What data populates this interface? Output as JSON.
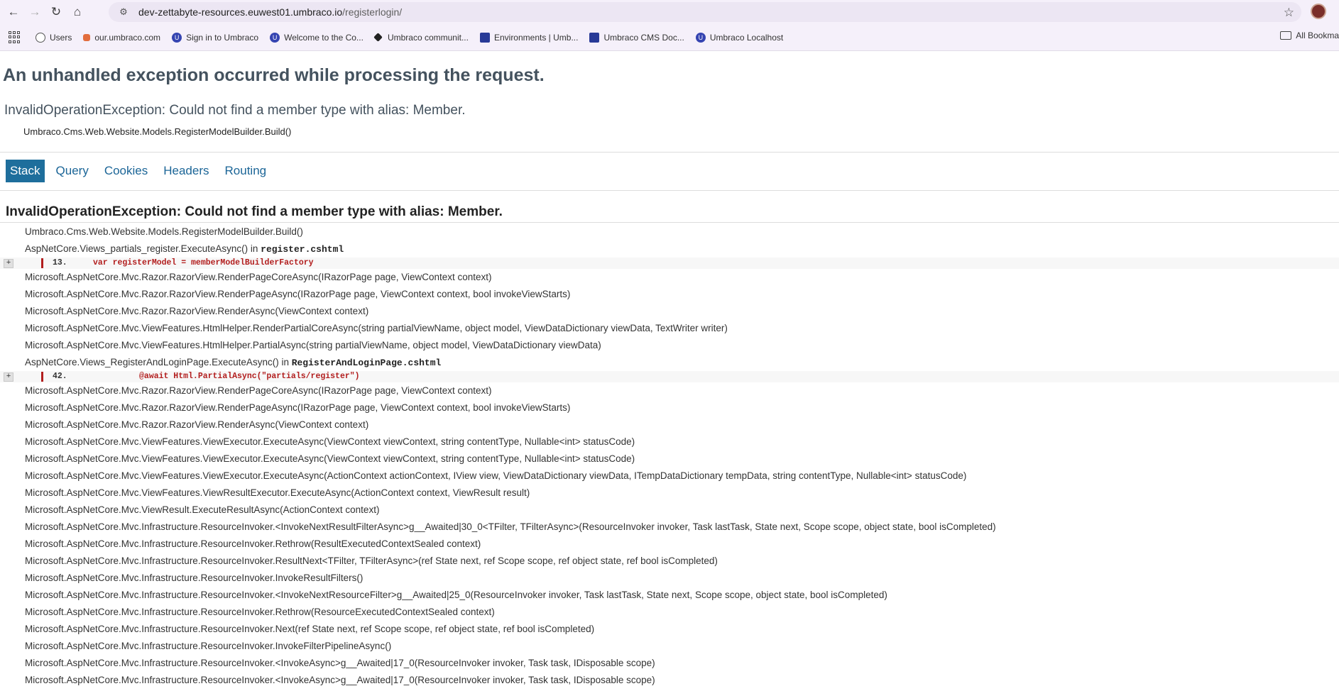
{
  "browser": {
    "url_host": "dev-zettabyte-resources.euwest01.umbraco.io",
    "url_path": "/registerlogin/",
    "bookmarks": [
      {
        "label": "Users",
        "icon": "globe-icon"
      },
      {
        "label": "our.umbraco.com",
        "icon": "umbraco-small-icon"
      },
      {
        "label": "Sign in to Umbraco",
        "icon": "umbraco-icon"
      },
      {
        "label": "Welcome to the Co...",
        "icon": "umbraco-icon"
      },
      {
        "label": "Umbraco communit...",
        "icon": "diamond-icon"
      },
      {
        "label": "Environments | Umb...",
        "icon": "flag-icon"
      },
      {
        "label": "Umbraco CMS Doc...",
        "icon": "flag-icon"
      },
      {
        "label": "Umbraco Localhost",
        "icon": "umbraco-icon"
      }
    ],
    "all_bookmarks_label": "All Bookma"
  },
  "error": {
    "title": "An unhandled exception occurred while processing the request.",
    "message": "InvalidOperationException: Could not find a member type with alias: Member.",
    "location": "Umbraco.Cms.Web.Website.Models.RegisterModelBuilder.Build()"
  },
  "tabs": [
    {
      "label": "Stack",
      "active": true
    },
    {
      "label": "Query",
      "active": false
    },
    {
      "label": "Cookies",
      "active": false
    },
    {
      "label": "Headers",
      "active": false
    },
    {
      "label": "Routing",
      "active": false
    }
  ],
  "stack": {
    "exception_title": "InvalidOperationException: Could not find a member type with alias: Member.",
    "frames": [
      {
        "text": "Umbraco.Cms.Web.Website.Models.RegisterModelBuilder.Build()"
      },
      {
        "text": "AspNetCore.Views_partials_register.ExecuteAsync() in ",
        "file": "register.cshtml",
        "code": {
          "line": "13.",
          "source": "var registerModel = memberModelBuilderFactory",
          "indent": 0
        }
      },
      {
        "text": "Microsoft.AspNetCore.Mvc.Razor.RazorView.RenderPageCoreAsync(IRazorPage page, ViewContext context)"
      },
      {
        "text": "Microsoft.AspNetCore.Mvc.Razor.RazorView.RenderPageAsync(IRazorPage page, ViewContext context, bool invokeViewStarts)"
      },
      {
        "text": "Microsoft.AspNetCore.Mvc.Razor.RazorView.RenderAsync(ViewContext context)"
      },
      {
        "text": "Microsoft.AspNetCore.Mvc.ViewFeatures.HtmlHelper.RenderPartialCoreAsync(string partialViewName, object model, ViewDataDictionary viewData, TextWriter writer)"
      },
      {
        "text": "Microsoft.AspNetCore.Mvc.ViewFeatures.HtmlHelper.PartialAsync(string partialViewName, object model, ViewDataDictionary viewData)"
      },
      {
        "text": "AspNetCore.Views_RegisterAndLoginPage.ExecuteAsync() in ",
        "file": "RegisterAndLoginPage.cshtml",
        "code": {
          "line": "42.",
          "source": "@await Html.PartialAsync(\"partials/register\")",
          "indent": 1
        }
      },
      {
        "text": "Microsoft.AspNetCore.Mvc.Razor.RazorView.RenderPageCoreAsync(IRazorPage page, ViewContext context)"
      },
      {
        "text": "Microsoft.AspNetCore.Mvc.Razor.RazorView.RenderPageAsync(IRazorPage page, ViewContext context, bool invokeViewStarts)"
      },
      {
        "text": "Microsoft.AspNetCore.Mvc.Razor.RazorView.RenderAsync(ViewContext context)"
      },
      {
        "text": "Microsoft.AspNetCore.Mvc.ViewFeatures.ViewExecutor.ExecuteAsync(ViewContext viewContext, string contentType, Nullable<int> statusCode)"
      },
      {
        "text": "Microsoft.AspNetCore.Mvc.ViewFeatures.ViewExecutor.ExecuteAsync(ViewContext viewContext, string contentType, Nullable<int> statusCode)"
      },
      {
        "text": "Microsoft.AspNetCore.Mvc.ViewFeatures.ViewExecutor.ExecuteAsync(ActionContext actionContext, IView view, ViewDataDictionary viewData, ITempDataDictionary tempData, string contentType, Nullable<int> statusCode)"
      },
      {
        "text": "Microsoft.AspNetCore.Mvc.ViewFeatures.ViewResultExecutor.ExecuteAsync(ActionContext context, ViewResult result)"
      },
      {
        "text": "Microsoft.AspNetCore.Mvc.ViewResult.ExecuteResultAsync(ActionContext context)"
      },
      {
        "text": "Microsoft.AspNetCore.Mvc.Infrastructure.ResourceInvoker.<InvokeNextResultFilterAsync>g__Awaited|30_0<TFilter, TFilterAsync>(ResourceInvoker invoker, Task lastTask, State next, Scope scope, object state, bool isCompleted)"
      },
      {
        "text": "Microsoft.AspNetCore.Mvc.Infrastructure.ResourceInvoker.Rethrow(ResultExecutedContextSealed context)"
      },
      {
        "text": "Microsoft.AspNetCore.Mvc.Infrastructure.ResourceInvoker.ResultNext<TFilter, TFilterAsync>(ref State next, ref Scope scope, ref object state, ref bool isCompleted)"
      },
      {
        "text": "Microsoft.AspNetCore.Mvc.Infrastructure.ResourceInvoker.InvokeResultFilters()"
      },
      {
        "text": "Microsoft.AspNetCore.Mvc.Infrastructure.ResourceInvoker.<InvokeNextResourceFilter>g__Awaited|25_0(ResourceInvoker invoker, Task lastTask, State next, Scope scope, object state, bool isCompleted)"
      },
      {
        "text": "Microsoft.AspNetCore.Mvc.Infrastructure.ResourceInvoker.Rethrow(ResourceExecutedContextSealed context)"
      },
      {
        "text": "Microsoft.AspNetCore.Mvc.Infrastructure.ResourceInvoker.Next(ref State next, ref Scope scope, ref object state, ref bool isCompleted)"
      },
      {
        "text": "Microsoft.AspNetCore.Mvc.Infrastructure.ResourceInvoker.InvokeFilterPipelineAsync()"
      },
      {
        "text": "Microsoft.AspNetCore.Mvc.Infrastructure.ResourceInvoker.<InvokeAsync>g__Awaited|17_0(ResourceInvoker invoker, Task task, IDisposable scope)"
      },
      {
        "text": "Microsoft.AspNetCore.Mvc.Infrastructure.ResourceInvoker.<InvokeAsync>g__Awaited|17_0(ResourceInvoker invoker, Task task, IDisposable scope)"
      }
    ],
    "expand_label": "+"
  }
}
